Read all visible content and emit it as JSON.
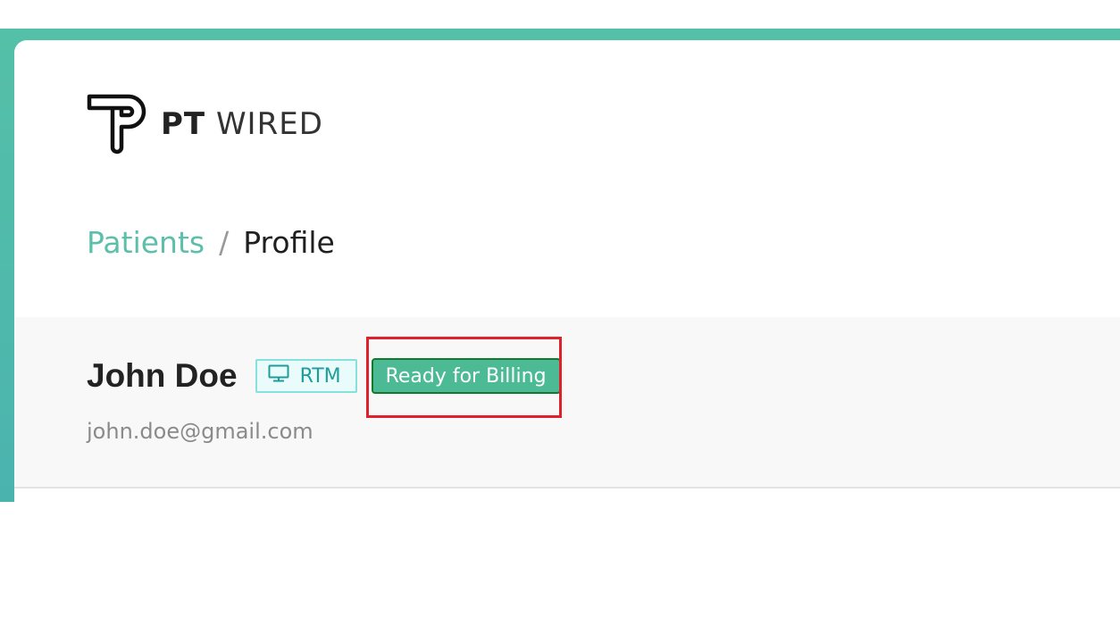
{
  "brand": {
    "logo_icon": "pt-wired-logo-icon",
    "name_bold": "PT",
    "name_light": "WIRED"
  },
  "breadcrumb": {
    "parent": "Patients",
    "separator": "/",
    "current": "Profile"
  },
  "patient": {
    "name": "John Doe",
    "email": "john.doe@gmail.com",
    "program_tag": {
      "icon": "monitor-icon",
      "label": "RTM"
    },
    "status_tag": {
      "label": "Ready for Billing"
    }
  },
  "colors": {
    "accent": "#5cbfa9",
    "status_green": "#4dba96",
    "highlight_red": "#e0202b"
  }
}
